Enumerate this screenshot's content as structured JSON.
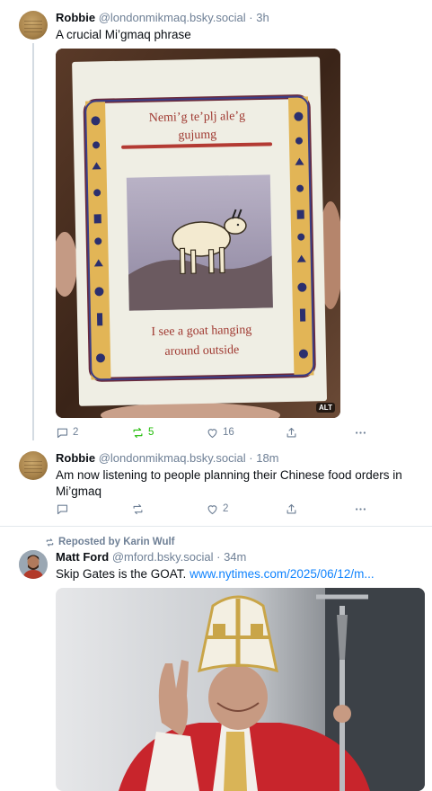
{
  "posts": [
    {
      "author": "Robbie",
      "handle": "@londonmikmaq.bsky.social",
      "time": "· 3h",
      "text": "A crucial Mi’gmaq phrase",
      "image": {
        "card_title_line1": "Nemi’g te’plj ale’g",
        "card_title_line2": "gujumg",
        "card_caption_line1": "I see a goat hanging",
        "card_caption_line2": "around outside",
        "alt_badge": "ALT"
      },
      "actions": {
        "reply_count": "2",
        "repost_count": "5",
        "like_count": "16"
      }
    },
    {
      "author": "Robbie",
      "handle": "@londonmikmaq.bsky.social",
      "time": "· 18m",
      "text_line1": "Am now listening to people planning their Chinese food orders in",
      "text_line2": "Mi’gmaq",
      "actions": {
        "reply_count": "",
        "repost_count": "",
        "like_count": "2"
      }
    },
    {
      "repost_label": "Reposted by Karin Wulf",
      "author": "Matt Ford",
      "handle": "@mford.bsky.social",
      "time": "· 34m",
      "text": "Skip Gates is the GOAT.",
      "link": "www.nytimes.com/2025/06/12/m..."
    }
  ],
  "colors": {
    "accent": "#1083fe",
    "repost_active": "#20bc07",
    "muted": "#6f8096"
  }
}
